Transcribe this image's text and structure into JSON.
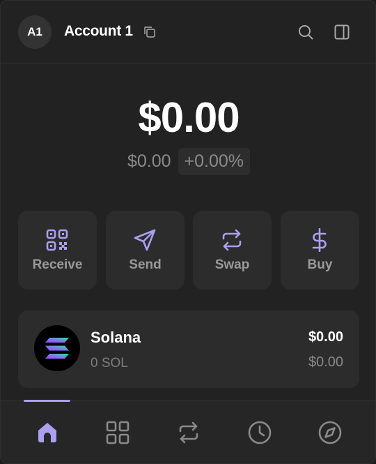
{
  "header": {
    "avatar_initials": "A1",
    "account_name": "Account 1",
    "icons": [
      "copy-icon",
      "search-icon",
      "sidebar-panel-icon"
    ]
  },
  "balance": {
    "total": "$0.00",
    "change_usd": "$0.00",
    "change_percent": "+0.00%"
  },
  "actions": [
    {
      "label": "Receive",
      "icon": "qr-code-icon"
    },
    {
      "label": "Send",
      "icon": "send-icon"
    },
    {
      "label": "Swap",
      "icon": "swap-icon"
    },
    {
      "label": "Buy",
      "icon": "dollar-icon"
    }
  ],
  "tokens": [
    {
      "name": "Solana",
      "amount": "0 SOL",
      "value": "$0.00",
      "change": "$0.00",
      "icon": "solana-logo"
    }
  ],
  "bottom_nav": {
    "items": [
      "home-icon",
      "grid-icon",
      "swap-icon",
      "clock-icon",
      "compass-icon"
    ],
    "active": 0
  },
  "colors": {
    "accent": "#ab9ff2",
    "background": "#222222",
    "card": "#2c2c2c",
    "muted_text": "#8a8a8a"
  }
}
